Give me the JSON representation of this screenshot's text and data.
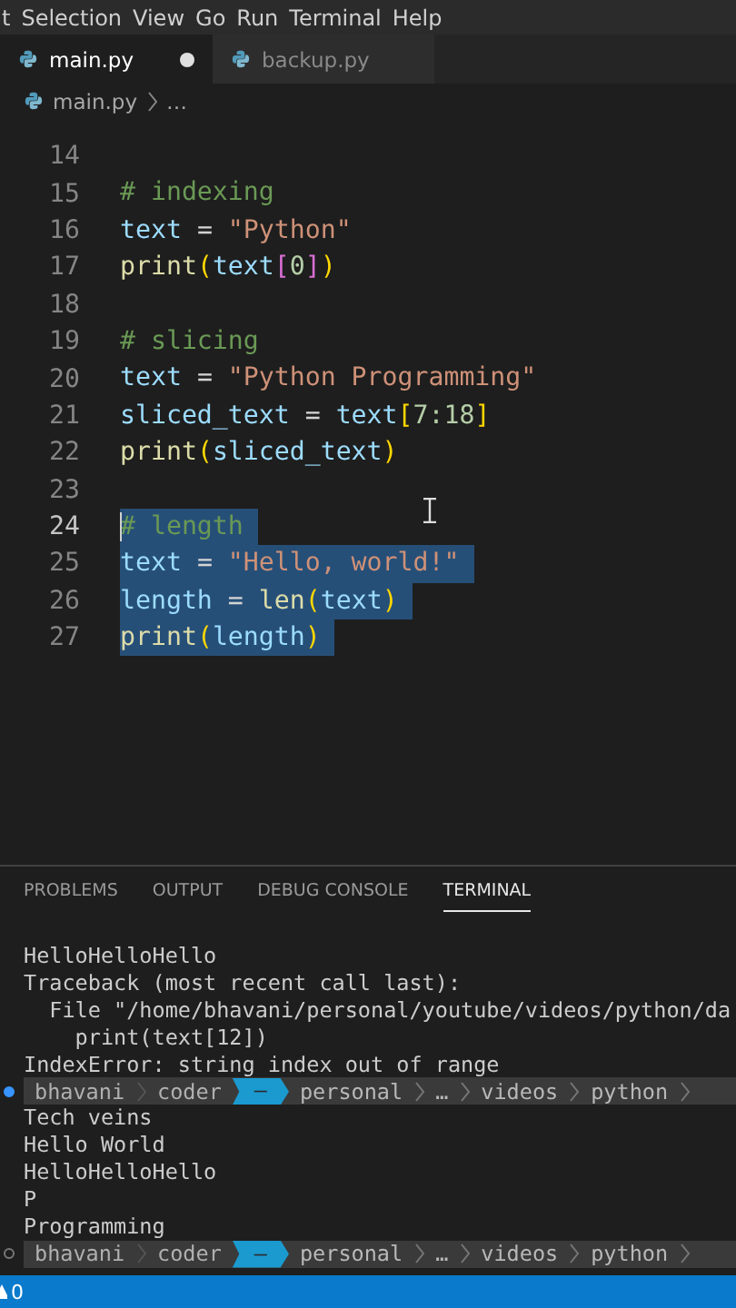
{
  "menu": [
    "t",
    "Selection",
    "View",
    "Go",
    "Run",
    "Terminal",
    "Help"
  ],
  "tabs": [
    {
      "label": "main.py",
      "selected": true,
      "modified": true
    },
    {
      "label": "backup.py",
      "selected": false,
      "modified": false
    }
  ],
  "breadcrumb": [
    "main.py",
    "…"
  ],
  "code_lines": [
    {
      "number": "14",
      "selected": false
    },
    {
      "number": "15",
      "selected": false,
      "tokens": [
        {
          "text": "# indexing",
          "kind": "comment"
        }
      ]
    },
    {
      "number": "16",
      "selected": false,
      "tokens": [
        {
          "text": "text",
          "kind": "var"
        },
        {
          "text": " = ",
          "kind": "op"
        },
        {
          "text": "\"Python\"",
          "kind": "str"
        }
      ]
    },
    {
      "number": "17",
      "selected": false,
      "tokens": [
        {
          "text": "print",
          "kind": "func"
        },
        {
          "text": "(",
          "kind": "paren"
        },
        {
          "text": "text",
          "kind": "var"
        },
        {
          "text": "[",
          "kind": "bracket"
        },
        {
          "text": "0",
          "kind": "num"
        },
        {
          "text": "]",
          "kind": "bracket"
        },
        {
          "text": ")",
          "kind": "paren"
        }
      ]
    },
    {
      "number": "18",
      "selected": false
    },
    {
      "number": "19",
      "selected": false,
      "tokens": [
        {
          "text": "# slicing",
          "kind": "comment"
        }
      ]
    },
    {
      "number": "20",
      "selected": false,
      "tokens": [
        {
          "text": "text",
          "kind": "var"
        },
        {
          "text": " = ",
          "kind": "op"
        },
        {
          "text": "\"Python Programming\"",
          "kind": "str"
        }
      ]
    },
    {
      "number": "21",
      "selected": false,
      "tokens": [
        {
          "text": "sliced_text",
          "kind": "var"
        },
        {
          "text": " = ",
          "kind": "op"
        },
        {
          "text": "text",
          "kind": "var"
        },
        {
          "text": "[",
          "kind": "paren"
        },
        {
          "text": "7:18",
          "kind": "num"
        },
        {
          "text": "]",
          "kind": "paren"
        }
      ]
    },
    {
      "number": "22",
      "selected": false,
      "tokens": [
        {
          "text": "print",
          "kind": "func"
        },
        {
          "text": "(",
          "kind": "paren"
        },
        {
          "text": "sliced_text",
          "kind": "var"
        },
        {
          "text": ")",
          "kind": "paren"
        }
      ]
    },
    {
      "number": "23",
      "selected": false
    },
    {
      "number": "24",
      "selected": true,
      "tokens": [
        {
          "text": "# length",
          "kind": "comment"
        }
      ]
    },
    {
      "number": "25",
      "selected": true,
      "tokens": [
        {
          "text": "text",
          "kind": "var"
        },
        {
          "text": " = ",
          "kind": "op"
        },
        {
          "text": "\"Hello, world!\"",
          "kind": "str"
        }
      ]
    },
    {
      "number": "26",
      "selected": true,
      "tokens": [
        {
          "text": "length",
          "kind": "var"
        },
        {
          "text": " = ",
          "kind": "op"
        },
        {
          "text": "len",
          "kind": "func"
        },
        {
          "text": "(",
          "kind": "paren"
        },
        {
          "text": "text",
          "kind": "var"
        },
        {
          "text": ")",
          "kind": "paren"
        }
      ]
    },
    {
      "number": "27",
      "selected": true,
      "tokens": [
        {
          "text": "print",
          "kind": "func"
        },
        {
          "text": "(",
          "kind": "paren"
        },
        {
          "text": "length",
          "kind": "var"
        },
        {
          "text": ")",
          "kind": "paren"
        }
      ]
    }
  ],
  "panel_tabs": [
    {
      "label": "PROBLEMS",
      "selected": false
    },
    {
      "label": "OUTPUT",
      "selected": false
    },
    {
      "label": "DEBUG CONSOLE",
      "selected": false
    },
    {
      "label": "TERMINAL",
      "selected": true
    }
  ],
  "terminal": [
    {
      "kind": "text",
      "text": "HelloHelloHello"
    },
    {
      "kind": "text",
      "text": "Traceback (most recent call last):"
    },
    {
      "kind": "text",
      "text": "  File \"/home/bhavani/personal/youtube/videos/python/da"
    },
    {
      "kind": "text",
      "text": "    print(text[12])"
    },
    {
      "kind": "text",
      "text": "IndexError: string index out of range"
    },
    {
      "kind": "prompt",
      "marker_filled": true,
      "user": "bhavani",
      "host": "coder",
      "branch": "–",
      "path": [
        "personal",
        "…",
        "videos",
        "python"
      ]
    },
    {
      "kind": "text",
      "text": "Tech veins"
    },
    {
      "kind": "text",
      "text": "Hello World"
    },
    {
      "kind": "text",
      "text": "HelloHelloHello"
    },
    {
      "kind": "text",
      "text": "P"
    },
    {
      "kind": "text",
      "text": "Programming"
    },
    {
      "kind": "prompt",
      "marker_filled": false,
      "user": "bhavani",
      "host": "coder",
      "branch": "–",
      "path": [
        "personal",
        "…",
        "videos",
        "python"
      ]
    }
  ],
  "status_bar": {
    "warnings": "0"
  }
}
